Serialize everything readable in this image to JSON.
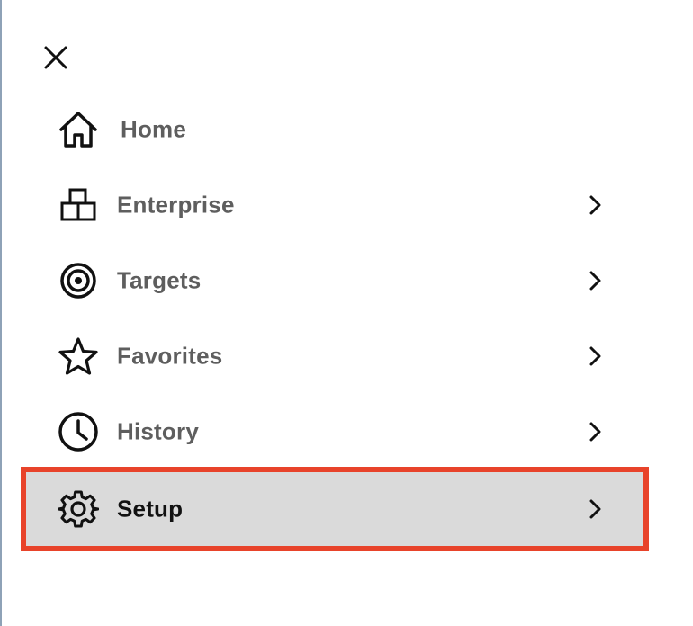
{
  "menu": {
    "items": [
      {
        "id": "home",
        "label": "Home",
        "icon": "home-icon",
        "has_chevron": false,
        "selected": false
      },
      {
        "id": "enterprise",
        "label": "Enterprise",
        "icon": "enterprise-icon",
        "has_chevron": true,
        "selected": false
      },
      {
        "id": "targets",
        "label": "Targets",
        "icon": "target-icon",
        "has_chevron": true,
        "selected": false
      },
      {
        "id": "favorites",
        "label": "Favorites",
        "icon": "star-icon",
        "has_chevron": true,
        "selected": false
      },
      {
        "id": "history",
        "label": "History",
        "icon": "clock-icon",
        "has_chevron": true,
        "selected": false
      },
      {
        "id": "setup",
        "label": "Setup",
        "icon": "gear-icon",
        "has_chevron": true,
        "selected": true
      }
    ]
  },
  "colors": {
    "highlight_border": "#e8432a",
    "selected_bg": "#dadada",
    "label_text": "#5e5e5e",
    "selected_label_text": "#111111"
  }
}
